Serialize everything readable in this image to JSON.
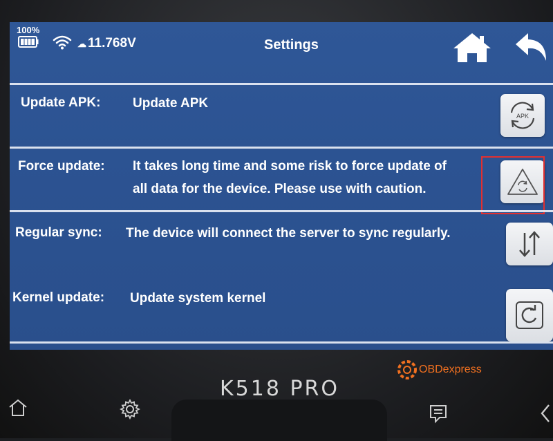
{
  "status": {
    "battery_percent": "100%",
    "voltage": "11.768V"
  },
  "header": {
    "title": "Settings"
  },
  "rows": [
    {
      "label": "Update APK:",
      "desc1": "Update APK",
      "desc2": "",
      "icon": "apk-update-icon"
    },
    {
      "label": "Force update:",
      "desc1": "It takes long time and some risk to force update of",
      "desc2": "all data for the device. Please use with caution.",
      "icon": "warning-refresh-icon"
    },
    {
      "label": "Regular sync:",
      "desc1": "The device will connect the server to sync regularly.",
      "desc2": "",
      "icon": "sync-arrows-icon"
    },
    {
      "label": "Kernel update:",
      "desc1": "Update system kernel",
      "desc2": "",
      "icon": "refresh-icon"
    }
  ],
  "apk_icon_text": "APK",
  "device": {
    "brand": "K518 PRO"
  },
  "watermark": {
    "text": "OBDexpress"
  },
  "colors": {
    "screen_blue": "#2c5392",
    "highlight_red": "#e23030",
    "watermark_orange": "#f07020"
  }
}
